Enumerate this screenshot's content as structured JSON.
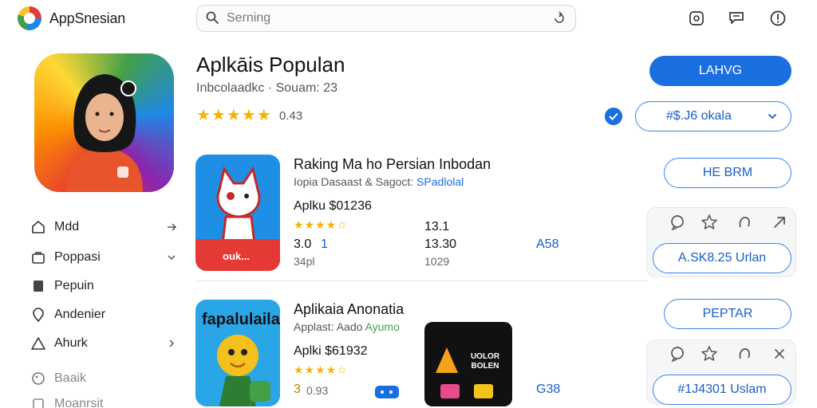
{
  "header": {
    "app_name": "AppSnesian",
    "search_placeholder": "Serning"
  },
  "featured": {
    "title": "Aplkāis Populan",
    "subtitle": "Inbcolaadkc · Souam: 23",
    "stars": "★★★★★",
    "rating": "0.43",
    "primary_button": "LAHVG",
    "secondary_button": "#$.J6 okala"
  },
  "sidebar": {
    "items": [
      {
        "label": "Mdd"
      },
      {
        "label": "Poppasi"
      },
      {
        "label": "Pepuin"
      },
      {
        "label": "Andenier"
      },
      {
        "label": "Ahurk"
      },
      {
        "label": "Baaik"
      },
      {
        "label": "Moanrsit"
      }
    ]
  },
  "list": [
    {
      "icon_label": "ouk...",
      "title": "Raking Ma ho Persian Inbodan",
      "subtitle": "Iopia Dasaast & Sagoct:",
      "subtitle_accent": "SPadlolal",
      "price": "Aplku $01236",
      "stars": "★★★★☆",
      "rating": "3.0",
      "rating_count": "1",
      "extra": "34pl",
      "stat_top": "13.1",
      "stat_mid": "13.30",
      "stat_bottom": "1029",
      "blue_value": "A58",
      "button": "HE BRM",
      "bottom_button": "A.SK8.25 Urlan"
    },
    {
      "icon_label": "fapalulailar",
      "title": "Aplikaia Anonatia",
      "subtitle": "Applast: Aado",
      "subtitle_accent": "Ayumo",
      "price": "Aplki $61932",
      "stars": "★★★★☆",
      "rating": "3",
      "rating_count": "0.93",
      "screenshot_text": "UOLOR BOLEN",
      "blue_value": "G38",
      "button": "PEPTAR",
      "bottom_button": "#1J4301 Uslam"
    }
  ]
}
